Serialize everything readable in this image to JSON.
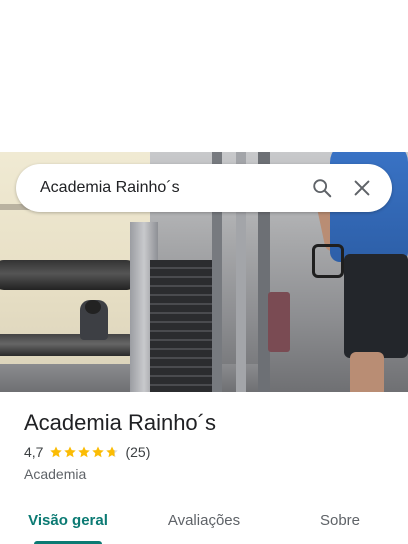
{
  "search": {
    "query": "Academia Rainho´s"
  },
  "place": {
    "title": "Academia Rainho´s",
    "rating": "4,7",
    "rating_value": 4.7,
    "review_count": "(25)",
    "category": "Academia"
  },
  "tabs": [
    {
      "label": "Visão geral",
      "active": true
    },
    {
      "label": "Avaliações",
      "active": false
    },
    {
      "label": "Sobre",
      "active": false
    }
  ],
  "icons": {
    "search": "search-icon",
    "close": "close-icon",
    "star": "star-icon"
  },
  "colors": {
    "accent": "#0b7a73",
    "star": "#fbbc04"
  }
}
